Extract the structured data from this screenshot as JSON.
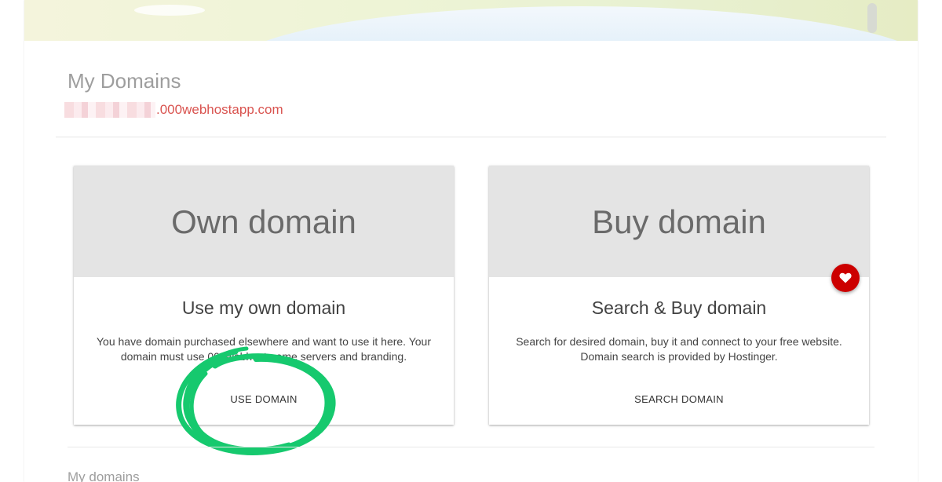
{
  "page": {
    "title": "My Domains",
    "site_domain_suffix": ".000webhostapp.com"
  },
  "cards": {
    "own": {
      "media_title": "Own domain",
      "heading": "Use my own domain",
      "description_line1": "You have domain purchased elsewhere and want to use it here. Your",
      "description_line2": "domain must use 000webhost name servers and branding.",
      "action_label": "USE DOMAIN"
    },
    "buy": {
      "media_title": "Buy domain",
      "heading": "Search & Buy domain",
      "description_line1": "Search for desired domain, buy it and connect to your free website.",
      "description_line2": "Domain search is provided by Hostinger.",
      "action_label": "SEARCH DOMAIN",
      "badge_icon": "heart-icon"
    }
  },
  "sections": {
    "my_domains_title": "My domains"
  },
  "colors": {
    "accent_red": "#d9534f",
    "fav_button": "#cc0000",
    "annotation_green": "#16c96e",
    "card_media_bg": "#e4e4e4"
  }
}
